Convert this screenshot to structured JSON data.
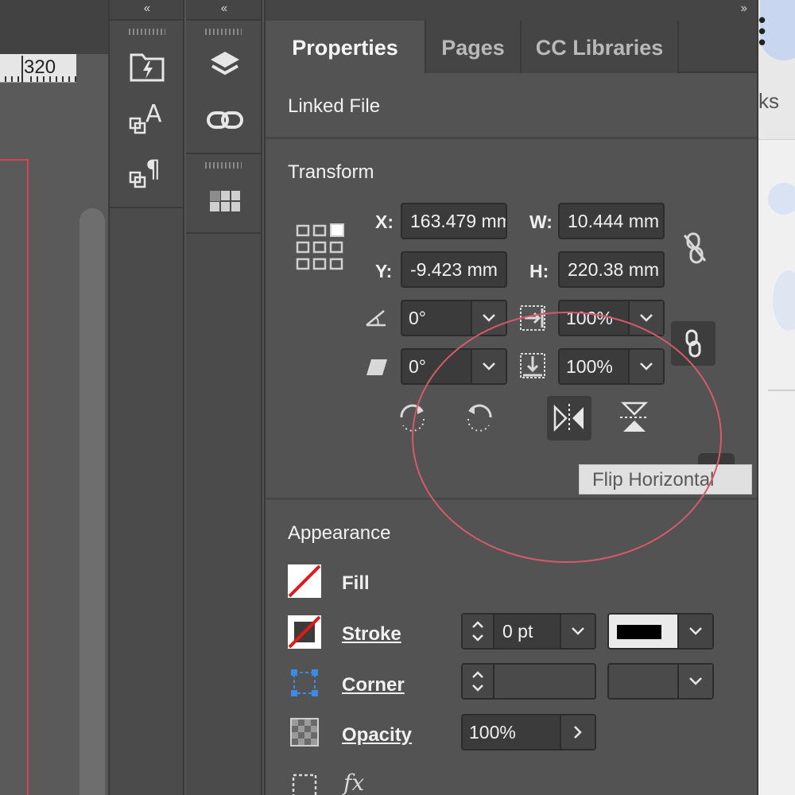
{
  "ruler": {
    "value": "320"
  },
  "collapse": {
    "left": "‹‹",
    "right": "››"
  },
  "tabs": [
    {
      "label": "Properties"
    },
    {
      "label": "Pages"
    },
    {
      "label": "CC Libraries"
    }
  ],
  "sections": {
    "linked_file": "Linked File",
    "transform": "Transform",
    "appearance": "Appearance"
  },
  "transform": {
    "x_label": "X:",
    "x_value": "163.479 mm",
    "y_label": "Y:",
    "y_value": "-9.423 mm",
    "w_label": "W:",
    "w_value": "10.444 mm",
    "h_label": "H:",
    "h_value": "220.38 mm",
    "rotation": "0°",
    "shear": "0°",
    "scale_x": "100%",
    "scale_y": "100%"
  },
  "tooltip": "Flip Horizontal",
  "appearance": {
    "fill_label": "Fill",
    "stroke_label": "Stroke",
    "stroke_weight": "0 pt",
    "corner_label": "Corner",
    "opacity_label": "Opacity",
    "opacity_value": "100%",
    "fx_label": "fx"
  },
  "right_strip": {
    "text": "ks"
  },
  "colors": {
    "annotation_circle": "#d6596b",
    "page_edge": "#d9435a",
    "corner_icon": "#3b8be6"
  }
}
